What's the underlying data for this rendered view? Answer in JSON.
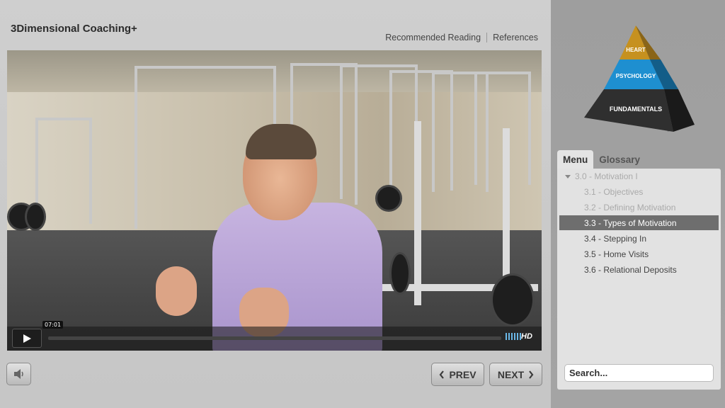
{
  "app": {
    "title": "3Dimensional Coaching+"
  },
  "header": {
    "links": [
      "Recommended Reading",
      "References"
    ]
  },
  "video": {
    "time": "07:01",
    "progress": 0.0,
    "quality_label": "HD"
  },
  "nav": {
    "prev_label": "PREV",
    "next_label": "NEXT"
  },
  "pyramid": {
    "levels": [
      "HEART",
      "PSYCHOLOGY",
      "FUNDAMENTALS"
    ],
    "colors": {
      "top": "#c6911f",
      "middle": "#1e8fd0",
      "bottom": "#2f2f2f"
    }
  },
  "sidebar": {
    "tabs": [
      "Menu",
      "Glossary"
    ],
    "active_tab": "Menu",
    "items": [
      {
        "label": "3.0 - Motivation I",
        "state": "dim",
        "section": true
      },
      {
        "label": "3.1 - Objectives",
        "state": "dim"
      },
      {
        "label": "3.2 - Defining Motivation",
        "state": "dim"
      },
      {
        "label": "3.3 - Types of Motivation",
        "state": "current"
      },
      {
        "label": "3.4 - Stepping In",
        "state": "normal"
      },
      {
        "label": "3.5 - Home Visits",
        "state": "normal"
      },
      {
        "label": "3.6 - Relational Deposits",
        "state": "normal"
      }
    ]
  },
  "search": {
    "placeholder": "Search..."
  }
}
